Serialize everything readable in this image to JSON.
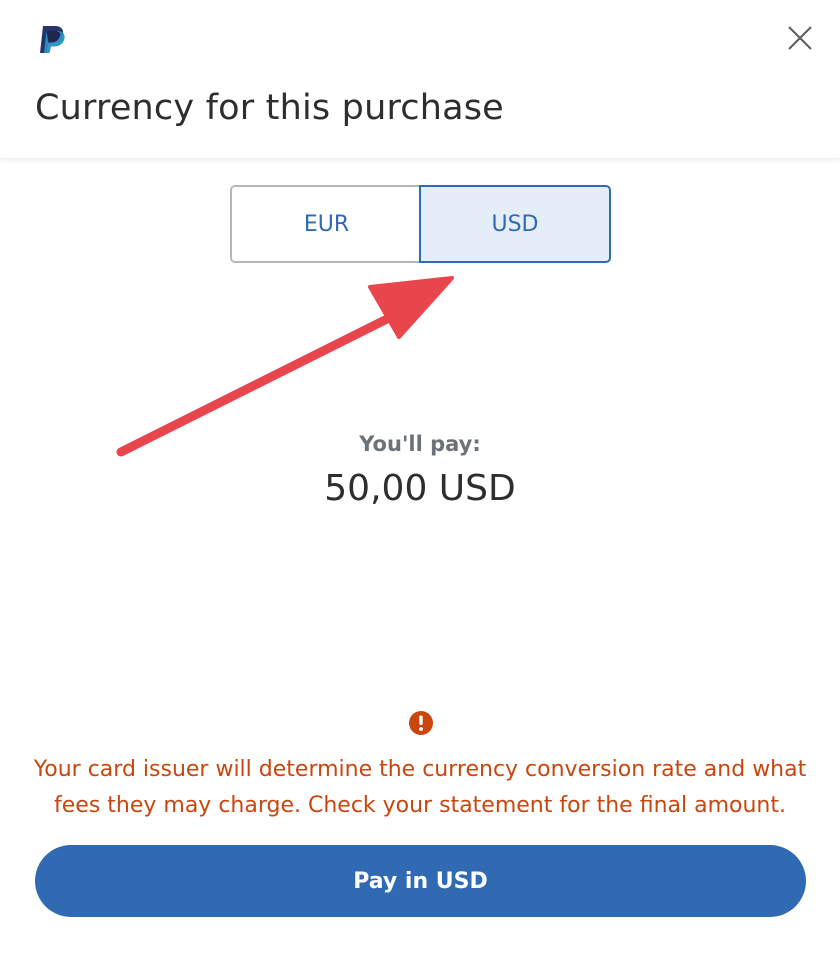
{
  "header": {
    "logo_icon": "paypal-logo-icon",
    "close_icon": "close-icon",
    "title": "Currency for this purchase"
  },
  "currency_selector": {
    "options": [
      {
        "label": "EUR",
        "selected": false
      },
      {
        "label": "USD",
        "selected": true
      }
    ]
  },
  "annotation": {
    "arrow_icon": "red-arrow-icon",
    "color": "#e8464c"
  },
  "summary": {
    "label": "You'll pay:",
    "amount": "50,00 USD"
  },
  "notice": {
    "icon": "exclamation-circle-icon",
    "text": "Your card issuer will determine the currency conversion rate and what fees they may charge. Check your statement for the final amount.",
    "color": "#c9460e"
  },
  "action": {
    "pay_label": "Pay in USD",
    "color": "#2f6ab3"
  }
}
